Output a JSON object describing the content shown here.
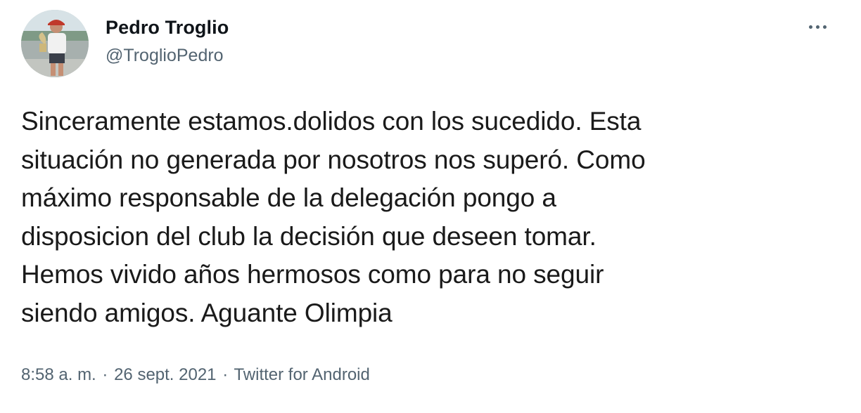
{
  "author": {
    "display_name": "Pedro Troglio",
    "handle": "@TroglioPedro",
    "avatar_icon": "profile-photo"
  },
  "more_icon": "more-options-icon",
  "tweet": {
    "lines": [
      "Sinceramente estamos.dolidos con los sucedido. Esta",
      "situación no generada por nosotros nos superó. Como",
      "máximo responsable de la delegación pongo a",
      "disposicion del club la decisión que deseen tomar.",
      "Hemos vivido años hermosos como para no seguir",
      "siendo amigos. Aguante Olimpia"
    ]
  },
  "meta": {
    "time": "8:58 a. m.",
    "separator": "·",
    "date": "26 sept. 2021",
    "source": "Twitter for Android"
  },
  "colors": {
    "secondary_text": "#536471",
    "primary_text": "#0f1419"
  }
}
